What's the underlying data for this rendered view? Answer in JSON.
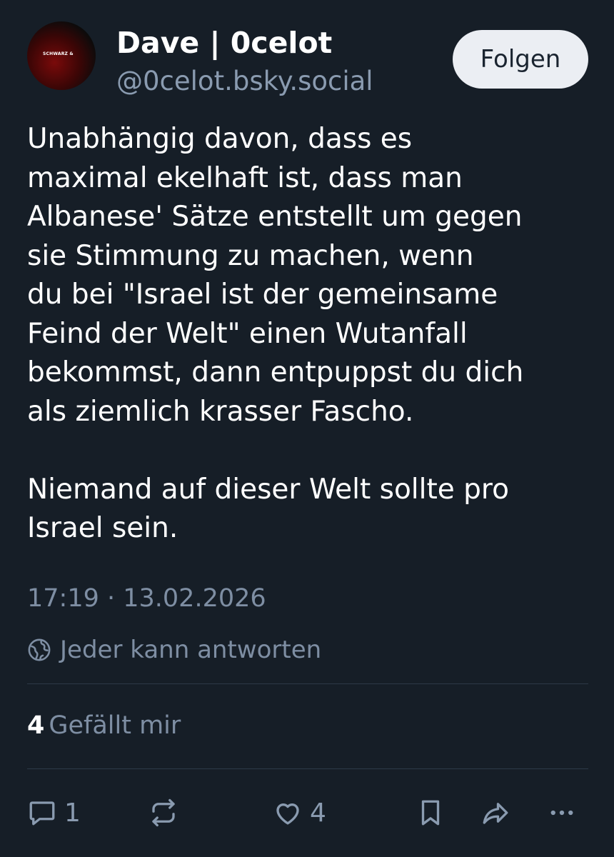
{
  "author": {
    "display_name": "Dave | 0celot",
    "handle": "@0celot.bsky.social",
    "avatar_text": "SCHWARZ & "
  },
  "follow_button": {
    "label": "Folgen"
  },
  "post": {
    "paragraphs": [
      "Unabhängig davon, dass es\nmaximal ekelhaft ist, dass man\nAlbanese' Sätze entstellt um gegen\nsie Stimmung zu machen, wenn\ndu bei \"Israel ist der gemeinsame\nFeind der Welt\" einen Wutanfall\nbekommst, dann entpuppst du dich\nals ziemlich krasser Fascho.",
      "Niemand auf dieser Welt sollte pro\nIsrael sein."
    ],
    "timestamp": "17:19 · 13.02.2026",
    "reply_setting": "Jeder kann antworten"
  },
  "stats": {
    "likes_count": "4",
    "likes_label": "Gefällt mir"
  },
  "actions": {
    "reply_count": "1",
    "like_count": "4"
  },
  "icons": {
    "reply": "speech-bubble-icon",
    "repost": "repost-arrows-icon",
    "like": "heart-icon",
    "bookmark": "bookmark-icon",
    "share": "share-arrow-icon",
    "more": "more-dots-icon",
    "reply_setting": "globe-icon"
  },
  "colors": {
    "background": "#161e27",
    "secondary_text": "#7e8ea3",
    "follow_button_bg": "#ebeef3"
  }
}
